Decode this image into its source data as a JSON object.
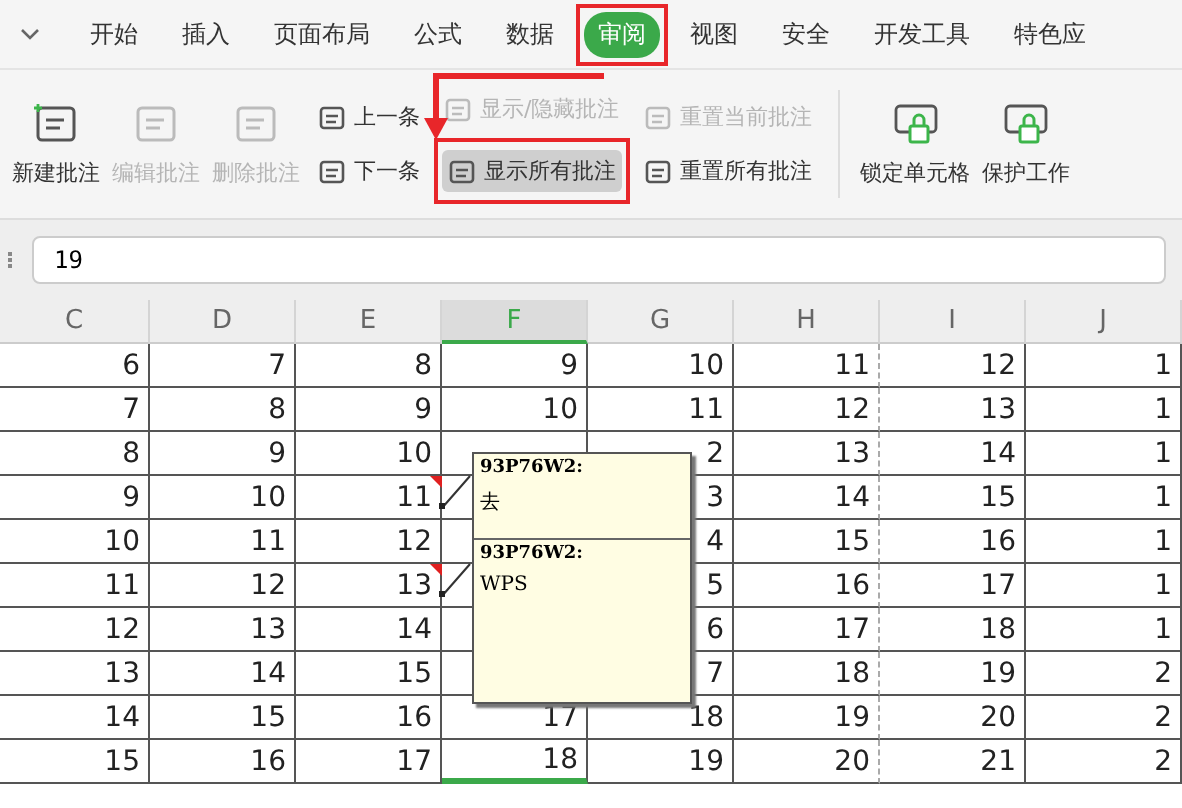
{
  "tabs": [
    {
      "label": "开始",
      "selected": false,
      "highlighted": false
    },
    {
      "label": "插入",
      "selected": false,
      "highlighted": false
    },
    {
      "label": "页面布局",
      "selected": false,
      "highlighted": false
    },
    {
      "label": "公式",
      "selected": false,
      "highlighted": false
    },
    {
      "label": "数据",
      "selected": false,
      "highlighted": false
    },
    {
      "label": "审阅",
      "selected": true,
      "highlighted": true
    },
    {
      "label": "视图",
      "selected": false,
      "highlighted": false
    },
    {
      "label": "安全",
      "selected": false,
      "highlighted": false
    },
    {
      "label": "开发工具",
      "selected": false,
      "highlighted": false
    },
    {
      "label": "特色应",
      "selected": false,
      "highlighted": false
    }
  ],
  "ribbon": [
    {
      "kind": "large",
      "label": "新建批注",
      "disabled": false
    },
    {
      "kind": "large",
      "label": "编辑批注",
      "disabled": true
    },
    {
      "kind": "large",
      "label": "删除批注",
      "disabled": true
    },
    {
      "kind": "stack",
      "items": [
        {
          "label": "上一条",
          "disabled": false,
          "pressed": false,
          "highlighted": false
        },
        {
          "label": "下一条",
          "disabled": false,
          "pressed": false,
          "highlighted": false
        }
      ]
    },
    {
      "kind": "stack",
      "items": [
        {
          "label": "显示/隐藏批注",
          "disabled": true,
          "pressed": false,
          "highlighted": false
        },
        {
          "label": "显示所有批注",
          "disabled": false,
          "pressed": true,
          "highlighted": true
        }
      ]
    },
    {
      "kind": "stack",
      "items": [
        {
          "label": "重置当前批注",
          "disabled": true,
          "pressed": false,
          "highlighted": false
        },
        {
          "label": "重置所有批注",
          "disabled": false,
          "pressed": false,
          "highlighted": false
        }
      ]
    },
    {
      "kind": "separator"
    },
    {
      "kind": "large",
      "label": "锁定单元格",
      "disabled": false
    },
    {
      "kind": "large",
      "label": "保护工作",
      "disabled": false
    }
  ],
  "formula_bar": {
    "value": "19"
  },
  "sheet": {
    "columns": [
      {
        "label": "C",
        "selected": false
      },
      {
        "label": "D",
        "selected": false
      },
      {
        "label": "E",
        "selected": false
      },
      {
        "label": "F",
        "selected": true
      },
      {
        "label": "G",
        "selected": false
      },
      {
        "label": "H",
        "selected": false
      },
      {
        "label": "I",
        "selected": false
      },
      {
        "label": "J",
        "selected": false
      }
    ],
    "rows": [
      {
        "cells": [
          "6",
          "7",
          "8",
          "9",
          "10",
          "11",
          "12",
          "1"
        ],
        "comment_marker": false
      },
      {
        "cells": [
          "7",
          "8",
          "9",
          "10",
          "11",
          "12",
          "13",
          "1"
        ],
        "comment_marker": false
      },
      {
        "cells": [
          "8",
          "9",
          "10",
          null,
          "2",
          "13",
          "14",
          "1"
        ],
        "comment_marker": false
      },
      {
        "cells": [
          "9",
          "10",
          "11",
          null,
          "3",
          "14",
          "15",
          "1"
        ],
        "comment_marker": true
      },
      {
        "cells": [
          "10",
          "11",
          "12",
          null,
          "4",
          "15",
          "16",
          "1"
        ],
        "comment_marker": false
      },
      {
        "cells": [
          "11",
          "12",
          "13",
          null,
          "5",
          "16",
          "17",
          "1"
        ],
        "comment_marker": true
      },
      {
        "cells": [
          "12",
          "13",
          "14",
          null,
          "6",
          "17",
          "18",
          "1"
        ],
        "comment_marker": false
      },
      {
        "cells": [
          "13",
          "14",
          "15",
          null,
          "7",
          "18",
          "19",
          "2"
        ],
        "comment_marker": false
      },
      {
        "cells": [
          "14",
          "15",
          "16",
          "17",
          "18",
          "19",
          "20",
          "2"
        ],
        "comment_marker": false
      },
      {
        "cells": [
          "15",
          "16",
          "17",
          "18",
          "19",
          "20",
          "21",
          "2"
        ],
        "comment_marker": false,
        "selected": true
      }
    ],
    "comments": [
      {
        "author": "93P76W2:",
        "text": "去"
      },
      {
        "author": "93P76W2:",
        "text": "WPS"
      }
    ]
  }
}
